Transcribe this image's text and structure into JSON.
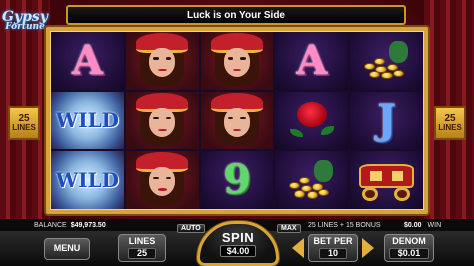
{
  "logo": {
    "line1": "Gypsy",
    "line2": "Fortune"
  },
  "banner": {
    "text": "Luck is on Your Side"
  },
  "lines_badge": {
    "value": "25",
    "label": "LINES"
  },
  "reels": [
    [
      "A",
      "WILD",
      "WILD"
    ],
    [
      "gypsy",
      "gypsy",
      "gypsy"
    ],
    [
      "gypsy",
      "gypsy",
      "9"
    ],
    [
      "A",
      "rose",
      "coins"
    ],
    [
      "coins",
      "J",
      "wagon"
    ]
  ],
  "info": {
    "balance_label": "BALANCE",
    "balance_value": "$49,973.50",
    "lines_bonus": "25 LINES + 15 BONUS",
    "win_value": "$0.00",
    "win_label": "WIN"
  },
  "controls": {
    "menu": "MENU",
    "lines_label": "LINES",
    "lines_value": "25",
    "auto": "AUTO",
    "spin_label": "SPIN",
    "spin_value": "$4.00",
    "max": "MAX",
    "bet_label": "BET PER",
    "bet_value": "10",
    "denom_label": "DENOM",
    "denom_value": "$0.01"
  },
  "colors": {
    "frame_gold": "#d6a43a",
    "reel_bg": "#1e0d38",
    "curtain": "#5a0a10"
  }
}
